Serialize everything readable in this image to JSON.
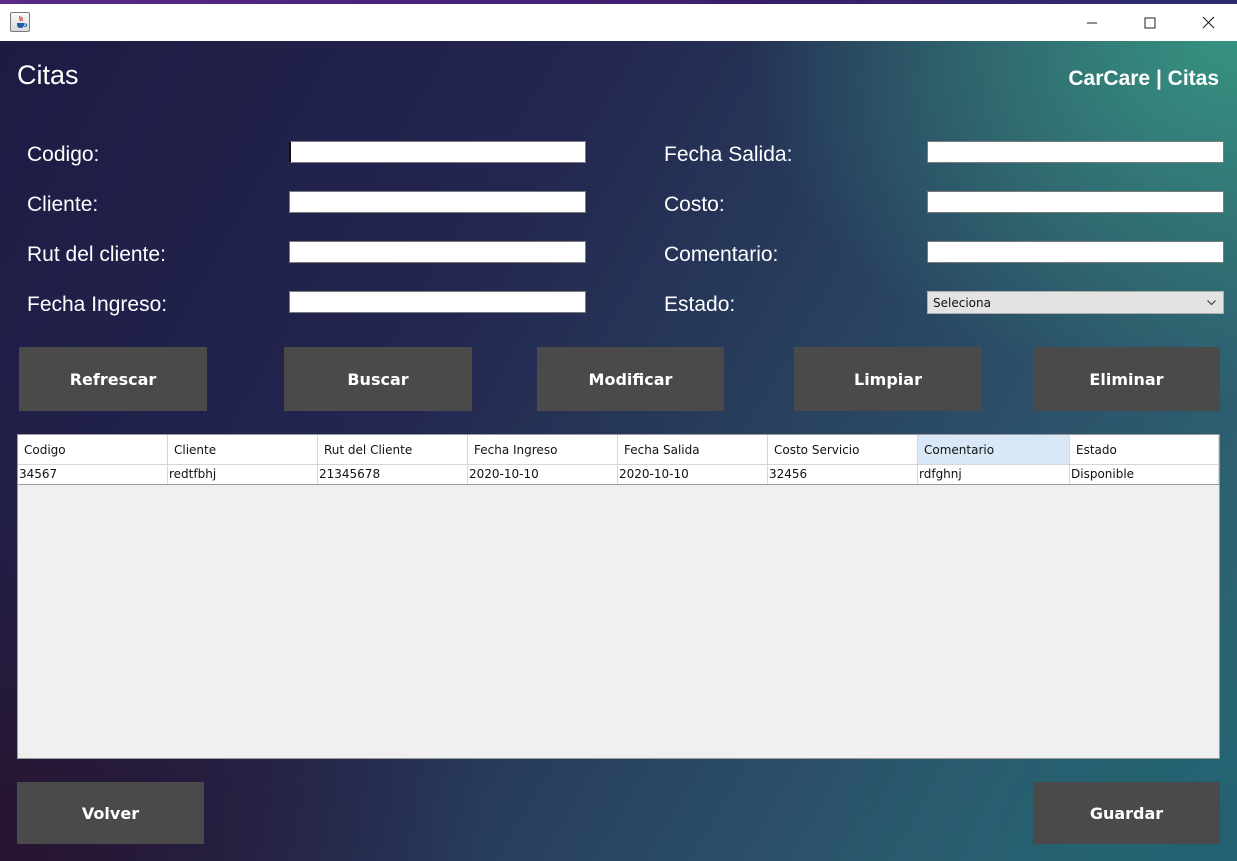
{
  "window": {
    "title_icon": "java-cup-icon"
  },
  "header": {
    "title": "Citas",
    "brand": "CarCare | Citas"
  },
  "form": {
    "codigo_label": "Codigo:",
    "cliente_label": "Cliente:",
    "rut_label": "Rut del cliente:",
    "fecha_ingreso_label": "Fecha Ingreso:",
    "fecha_salida_label": "Fecha Salida:",
    "costo_label": "Costo:",
    "comentario_label": "Comentario:",
    "estado_label": "Estado:",
    "codigo_value": "",
    "cliente_value": "",
    "rut_value": "",
    "fecha_ingreso_value": "",
    "fecha_salida_value": "",
    "costo_value": "",
    "comentario_value": "",
    "estado_selected": "Seleciona"
  },
  "actions": {
    "refrescar": "Refrescar",
    "buscar": "Buscar",
    "modificar": "Modificar",
    "limpiar": "Limpiar",
    "eliminar": "Eliminar"
  },
  "table": {
    "columns": [
      "Codigo",
      "Cliente",
      "Rut del Cliente",
      "Fecha Ingreso",
      "Fecha Salida",
      "Costo Servicio",
      "Comentario",
      "Estado"
    ],
    "rows": [
      [
        "34567",
        "redtfbhj",
        "21345678",
        "2020-10-10",
        "2020-10-10",
        "32456",
        "rdfghnj",
        "Disponible"
      ]
    ]
  },
  "footer": {
    "volver": "Volver",
    "guardar": "Guardar"
  },
  "colors": {
    "button_bg": "#4a4a4a",
    "header_selected": "#d9e8f6"
  }
}
